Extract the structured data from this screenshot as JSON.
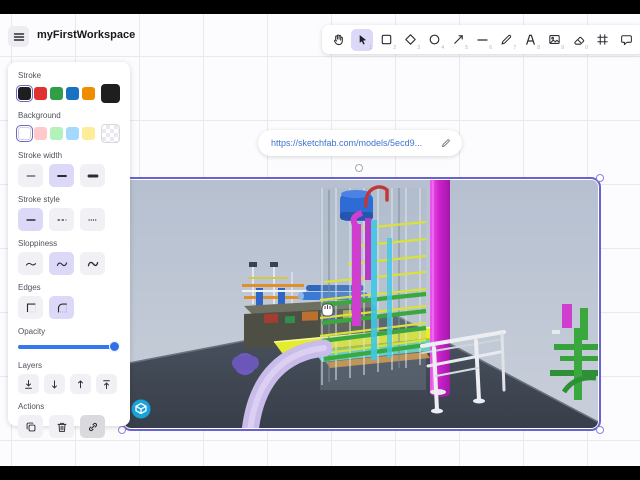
{
  "app": {
    "title": "myFirstWorkspace"
  },
  "toolbar": {
    "tools": [
      {
        "name": "hand",
        "shortcut": "",
        "active": false
      },
      {
        "name": "selection",
        "shortcut": "1",
        "active": true
      },
      {
        "name": "rectangle",
        "shortcut": "2",
        "active": false
      },
      {
        "name": "diamond",
        "shortcut": "3",
        "active": false
      },
      {
        "name": "ellipse",
        "shortcut": "4",
        "active": false
      },
      {
        "name": "arrow",
        "shortcut": "5",
        "active": false
      },
      {
        "name": "line",
        "shortcut": "6",
        "active": false
      },
      {
        "name": "draw",
        "shortcut": "7",
        "active": false
      },
      {
        "name": "text",
        "shortcut": "8",
        "active": false
      },
      {
        "name": "image",
        "shortcut": "9",
        "active": false
      },
      {
        "name": "eraser",
        "shortcut": "0",
        "active": false
      },
      {
        "name": "frame",
        "shortcut": "",
        "active": false
      },
      {
        "name": "comment",
        "shortcut": "",
        "active": false
      }
    ]
  },
  "panel": {
    "stroke": {
      "label": "Stroke",
      "palette": [
        "#1e1e1e",
        "#e03131",
        "#2f9e44",
        "#1971c2",
        "#f08c00"
      ],
      "selected_index": 0,
      "current": "#1e1e1e"
    },
    "background": {
      "label": "Background",
      "palette": [
        "transparent",
        "#ffc9c9",
        "#b2f2bb",
        "#a5d8ff",
        "#ffec99"
      ],
      "selected_index": 0,
      "current": "transparent"
    },
    "stroke_width": {
      "label": "Stroke width",
      "options": [
        "Thin",
        "Bold",
        "Extra bold"
      ],
      "selected": "Bold"
    },
    "stroke_style": {
      "label": "Stroke style",
      "options": [
        "Solid",
        "Dashed",
        "Dotted"
      ],
      "selected": "Solid"
    },
    "sloppiness": {
      "label": "Sloppiness",
      "options": [
        "Architect",
        "Artist",
        "Cartoonist"
      ],
      "selected": "Artist"
    },
    "edges": {
      "label": "Edges",
      "options": [
        "Sharp",
        "Round"
      ],
      "selected": "Round"
    },
    "opacity": {
      "label": "Opacity",
      "value": 100
    },
    "layers": {
      "label": "Layers",
      "options": [
        "Send to back",
        "Send backward",
        "Bring forward",
        "Bring to front"
      ]
    },
    "actions": {
      "label": "Actions",
      "options": [
        "Duplicate",
        "Delete",
        "Link"
      ],
      "active": "Link"
    }
  },
  "link_pill": {
    "url": "https://sketchfab.com/models/5ecd9..."
  },
  "embed": {
    "provider": "sketchfab-3d-viewer",
    "selected": true
  },
  "colors": {
    "accent": "#6963d2",
    "tool_selected_fill": "#dcd8f7",
    "slider_blue": "#3577ef",
    "link_text": "#3f73cf",
    "sketchfab_badge": "#17a3dc"
  }
}
